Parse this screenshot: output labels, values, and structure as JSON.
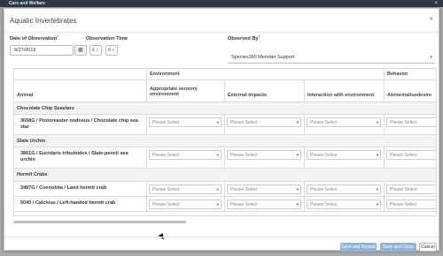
{
  "os_bar": {
    "title": "Care and Welfare",
    "close": "×"
  },
  "modal": {
    "title": "Aquatic Invertebrates",
    "close": "×"
  },
  "form": {
    "date_label": "Date of Observation",
    "date_value": "9/27/2019",
    "time_label": "Observation Time",
    "time_hour": "0",
    "time_minute": "0",
    "observed_by_label": "Observed By",
    "observed_by_value": "Species360 Member Support",
    "required_mark": "*"
  },
  "grid": {
    "group_headers": [
      "Environment",
      "Behavior"
    ],
    "columns": [
      "Animal",
      "Appropriate sensory environment",
      "External impacts",
      "Interaction with environment",
      "Abnormal/undesire"
    ],
    "placeholder": "Please Select",
    "groups": [
      {
        "label": "Chocolate Chip Seastars",
        "rows": [
          "3658G / Protoreaster nodosus / Chocolate chip sea star"
        ]
      },
      {
        "label": "Slate Urchin",
        "rows": [
          "3861G / Eucidaris tribuloides / Slate-pencil sea urchin"
        ]
      },
      {
        "label": "Hermit Crabs",
        "rows": [
          "3487G / Coenobita / Land hermit crab",
          "5040 / Calcinus / Left-handed hermit crab"
        ]
      }
    ]
  },
  "footer": {
    "save_repeat": "Save and Repeat",
    "save_close": "Save and Close",
    "cancel": "Cancel"
  },
  "colors": {
    "primary_button": "#8fb3d9",
    "required": "#d9534f"
  }
}
